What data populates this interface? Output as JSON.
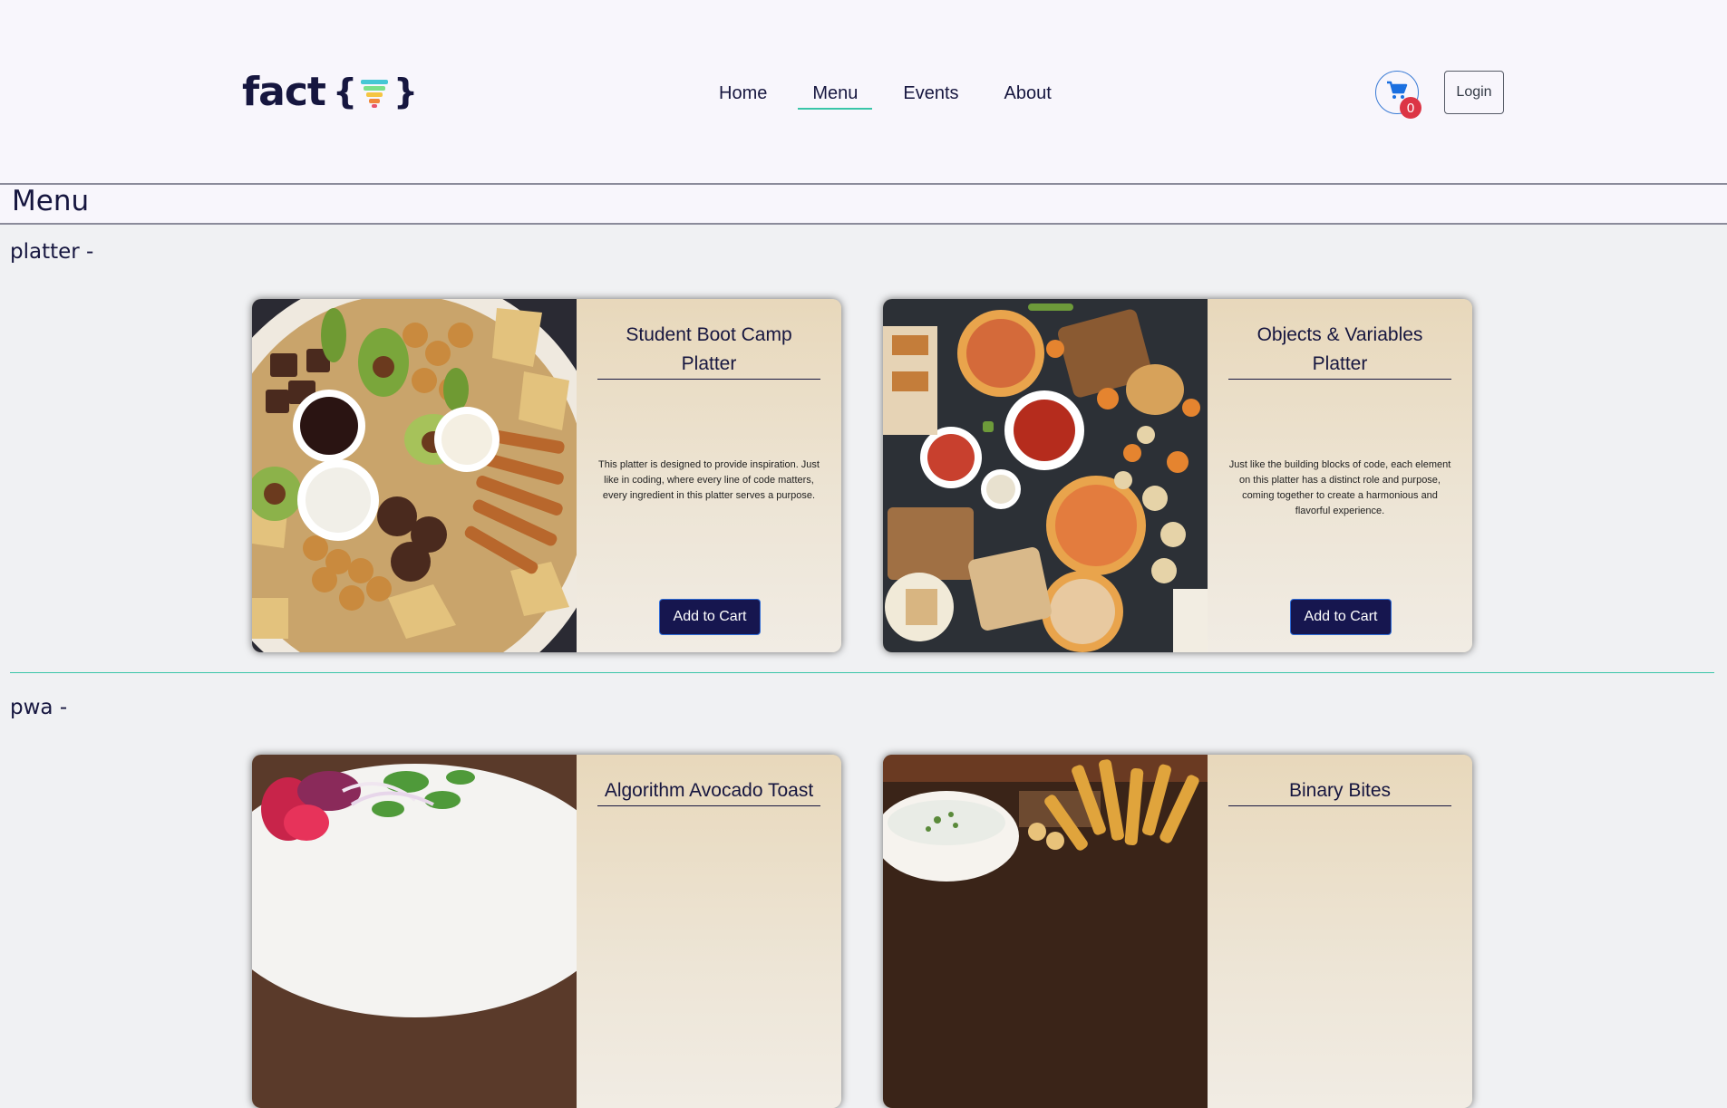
{
  "brand": {
    "logo_text": "fact",
    "logo_open": "{",
    "logo_close": "}"
  },
  "nav": {
    "items": [
      {
        "label": "Home"
      },
      {
        "label": "Menu",
        "active": true
      },
      {
        "label": "Events"
      },
      {
        "label": "About"
      }
    ]
  },
  "header": {
    "cart_count": "0",
    "cart_icon": "shopping-cart-icon",
    "login_label": "Login"
  },
  "page": {
    "title": "Menu"
  },
  "sections": [
    {
      "title": "platter -",
      "cards": [
        {
          "title": "Student Boot Camp Platter",
          "description": "This platter is designed to provide inspiration. Just like in coding, where every line of code matters, every ingredient in this platter serves a purpose.",
          "button": "Add to Cart"
        },
        {
          "title": "Objects & Variables Platter",
          "description": "Just like the building blocks of code, each element on this platter has a distinct role and purpose, coming together to create a harmonious and flavorful experience.",
          "button": "Add to Cart"
        }
      ]
    },
    {
      "title": "pwa -",
      "cards": [
        {
          "title": "Algorithm Avocado Toast"
        },
        {
          "title": "Binary Bites"
        }
      ]
    }
  ],
  "colors": {
    "accent": "#39c5a8",
    "primary": "#16163f",
    "badge": "#dc3545",
    "card_bg": "#e9dcc0"
  }
}
